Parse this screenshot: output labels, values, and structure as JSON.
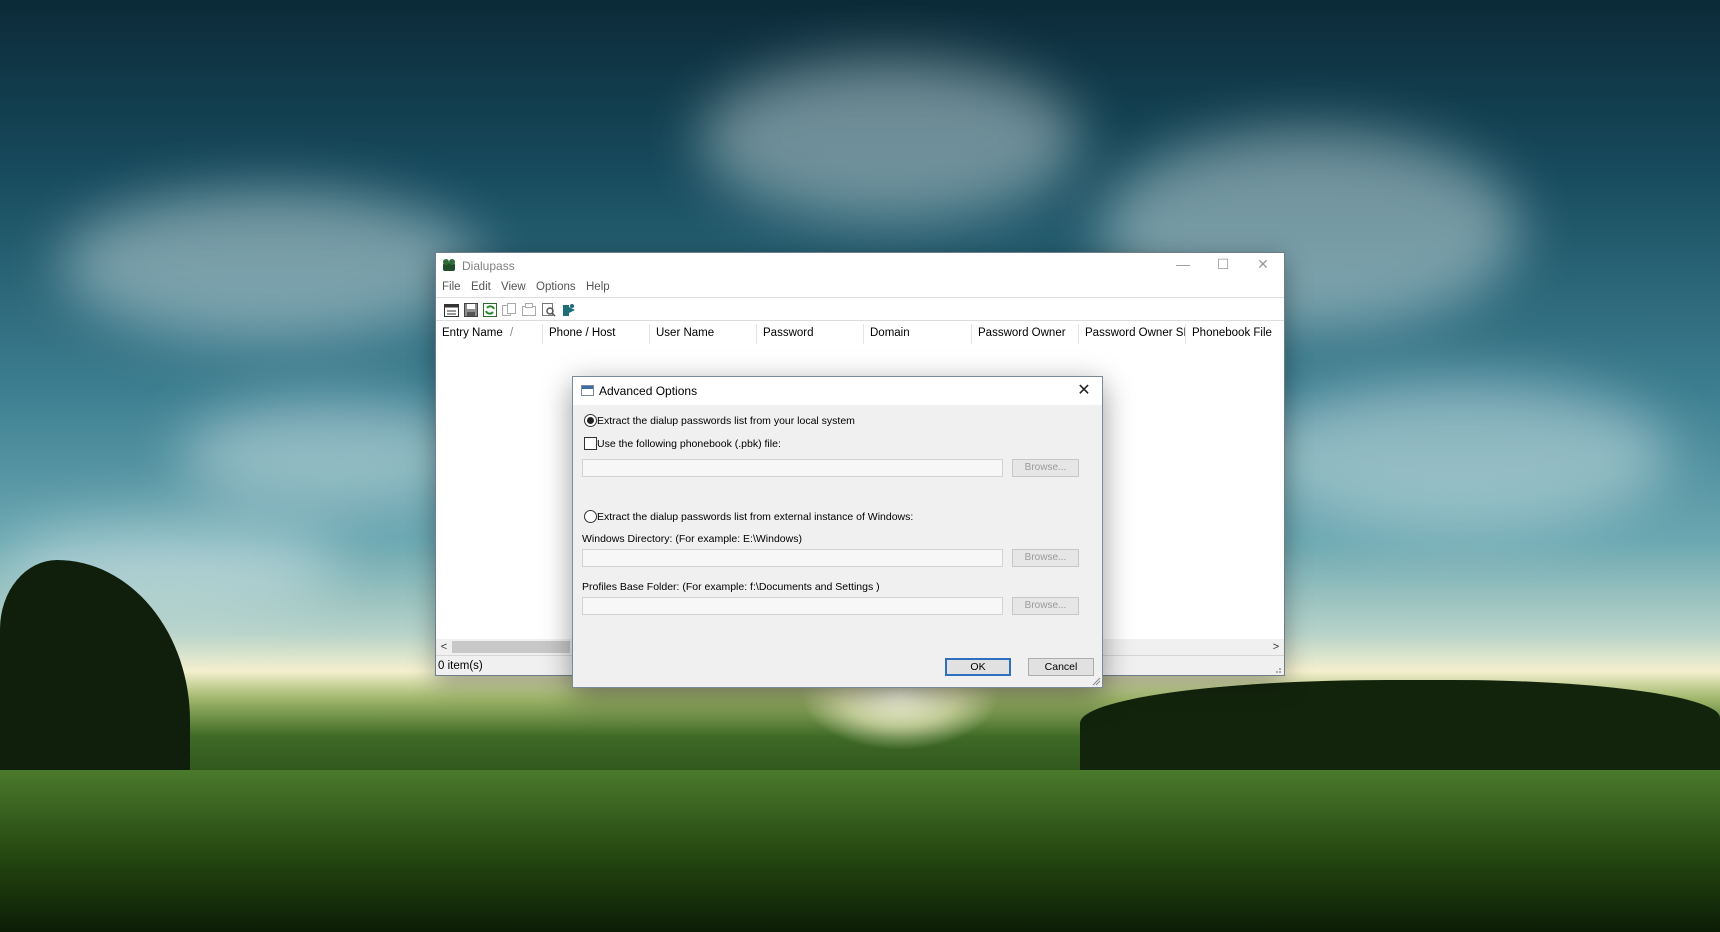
{
  "window": {
    "title": "Dialupass",
    "menu": [
      "File",
      "Edit",
      "View",
      "Options",
      "Help"
    ],
    "toolbar_icons": [
      "properties-icon",
      "save-icon",
      "refresh-icon",
      "copy-icon",
      "advanced-options-icon",
      "find-icon",
      "exit-icon"
    ],
    "columns": [
      "Entry Name",
      "Phone / Host",
      "User Name",
      "Password",
      "Domain",
      "Password Owner",
      "Password Owner SID",
      "Phonebook File"
    ],
    "sort_indicator": "/",
    "status": "0 item(s)",
    "scroll_left": "<",
    "scroll_right": ">",
    "caption": {
      "minimize": "—",
      "maximize": "☐",
      "close": "✕"
    }
  },
  "dialog": {
    "title": "Advanced Options",
    "close": "✕",
    "option_local": "Extract the dialup passwords list from your local system",
    "option_local_selected": true,
    "checkbox_phonebook": "Use the following phonebook (.pbk) file:",
    "checkbox_phonebook_checked": false,
    "phonebook_value": "",
    "browse_label": "Browse...",
    "option_external": "Extract the dialup passwords list from external instance of Windows:",
    "option_external_selected": false,
    "windows_dir_label": "Windows Directory:  (For example:  E:\\Windows)",
    "windows_dir_value": "",
    "profiles_label": "Profiles Base Folder:  (For example:  f:\\Documents and Settings )",
    "profiles_value": "",
    "ok_label": "OK",
    "cancel_label": "Cancel"
  },
  "colors": {
    "accent": "#2f6fbf",
    "disabled_text": "#9a9a9a",
    "dialog_bg": "#f0f0f0"
  }
}
